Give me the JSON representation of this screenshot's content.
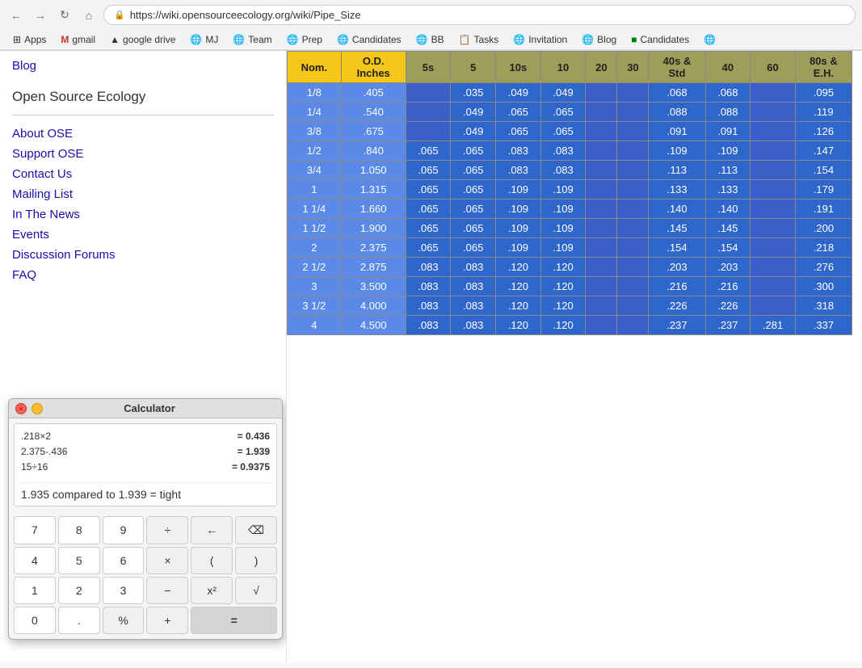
{
  "browser": {
    "url": "https://wiki.opensourceecology.org/wiki/Pipe_Size",
    "nav": {
      "back": "←",
      "forward": "→",
      "refresh": "↻",
      "home": "⌂"
    },
    "bookmarks": [
      {
        "label": "Apps",
        "icon": "⊞"
      },
      {
        "label": "gmail",
        "icon": "M"
      },
      {
        "label": "google drive",
        "icon": "△"
      },
      {
        "label": "MJ",
        "icon": "🌐"
      },
      {
        "label": "Team",
        "icon": "🌐"
      },
      {
        "label": "Prep",
        "icon": "🌐"
      },
      {
        "label": "Candidates",
        "icon": "🌐"
      },
      {
        "label": "BB",
        "icon": "🌐"
      },
      {
        "label": "Tasks",
        "icon": "📋"
      },
      {
        "label": "Invitation",
        "icon": "🌐"
      },
      {
        "label": "Blog",
        "icon": "🌐"
      },
      {
        "label": "Candidates",
        "icon": "🟢"
      },
      {
        "label": "more",
        "icon": "🌐"
      }
    ]
  },
  "sidebar": {
    "blog_label": "Blog",
    "site_title": "Open Source Ecology",
    "nav_items": [
      "About OSE",
      "Support OSE",
      "Contact Us",
      "Mailing List",
      "In The News",
      "Events",
      "Discussion Forums",
      "FAQ"
    ]
  },
  "calculator": {
    "title": "Calculator",
    "history": [
      {
        "expr": ".218×2",
        "result": "= 0.436"
      },
      {
        "expr": "2.375-.436",
        "result": "= 1.939"
      },
      {
        "expr": "15÷16",
        "result": "= 0.9375"
      }
    ],
    "result_text": "1.935 compared to 1.939 = tight",
    "buttons": [
      "7",
      "8",
      "9",
      "÷",
      "←",
      "⌫",
      "4",
      "5",
      "6",
      "×",
      "(",
      ")",
      "1",
      "2",
      "3",
      "−",
      "x²",
      "√",
      "0",
      ".",
      "%",
      "+",
      "=",
      ""
    ]
  },
  "table": {
    "headers": [
      "Nom.",
      "O.D.\nInches",
      "5s",
      "5",
      "10s",
      "10",
      "20",
      "30",
      "40s &\nStd",
      "40",
      "60",
      "80s &\nE.H."
    ],
    "rows": [
      [
        "1/8",
        ".405",
        "",
        ".035",
        ".049",
        ".049",
        "",
        "",
        ".068",
        ".068",
        "",
        ".095"
      ],
      [
        "1/4",
        ".540",
        "",
        ".049",
        ".065",
        ".065",
        "",
        "",
        ".088",
        ".088",
        "",
        ".119"
      ],
      [
        "3/8",
        ".675",
        "",
        ".049",
        ".065",
        ".065",
        "",
        "",
        ".091",
        ".091",
        "",
        ".126"
      ],
      [
        "1/2",
        ".840",
        ".065",
        ".065",
        ".083",
        ".083",
        "",
        "",
        ".109",
        ".109",
        "",
        ".147"
      ],
      [
        "3/4",
        "1.050",
        ".065",
        ".065",
        ".083",
        ".083",
        "",
        "",
        ".113",
        ".113",
        "",
        ".154"
      ],
      [
        "1",
        "1.315",
        ".065",
        ".065",
        ".109",
        ".109",
        "",
        "",
        ".133",
        ".133",
        "",
        ".179"
      ],
      [
        "1 1/4",
        "1.660",
        ".065",
        ".065",
        ".109",
        ".109",
        "",
        "",
        ".140",
        ".140",
        "",
        ".191"
      ],
      [
        "1 1/2",
        "1.900",
        ".065",
        ".065",
        ".109",
        ".109",
        "",
        "",
        ".145",
        ".145",
        "",
        ".200"
      ],
      [
        "2",
        "2.375",
        ".065",
        ".065",
        ".109",
        ".109",
        "",
        "",
        ".154",
        ".154",
        "",
        ".218"
      ],
      [
        "2 1/2",
        "2.875",
        ".083",
        ".083",
        ".120",
        ".120",
        "",
        "",
        ".203",
        ".203",
        "",
        ".276"
      ],
      [
        "3",
        "3.500",
        ".083",
        ".083",
        ".120",
        ".120",
        "",
        "",
        ".216",
        ".216",
        "",
        ".300"
      ],
      [
        "3 1/2",
        "4.000",
        ".083",
        ".083",
        ".120",
        ".120",
        "",
        "",
        ".226",
        ".226",
        "",
        ".318"
      ],
      [
        "4",
        "4.500",
        ".083",
        ".083",
        ".120",
        ".120",
        "",
        "",
        ".237",
        ".237",
        ".281",
        ".337"
      ]
    ]
  }
}
